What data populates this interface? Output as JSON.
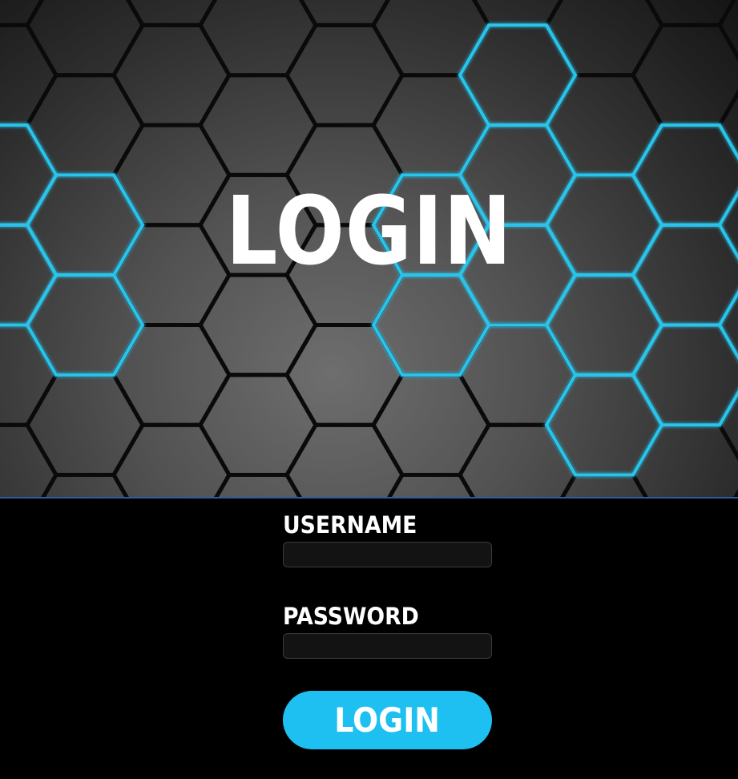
{
  "hero": {
    "title": "LOGIN",
    "pattern": "hexagon-grid",
    "accent_color": "#29c3ea"
  },
  "form": {
    "username_label": "USERNAME",
    "username_value": "",
    "password_label": "PASSWORD",
    "password_value": "",
    "submit_label": "LOGIN"
  },
  "colors": {
    "background": "#000000",
    "button": "#1ec0f2",
    "field": "#131313",
    "divider": "#2a5ea0"
  }
}
